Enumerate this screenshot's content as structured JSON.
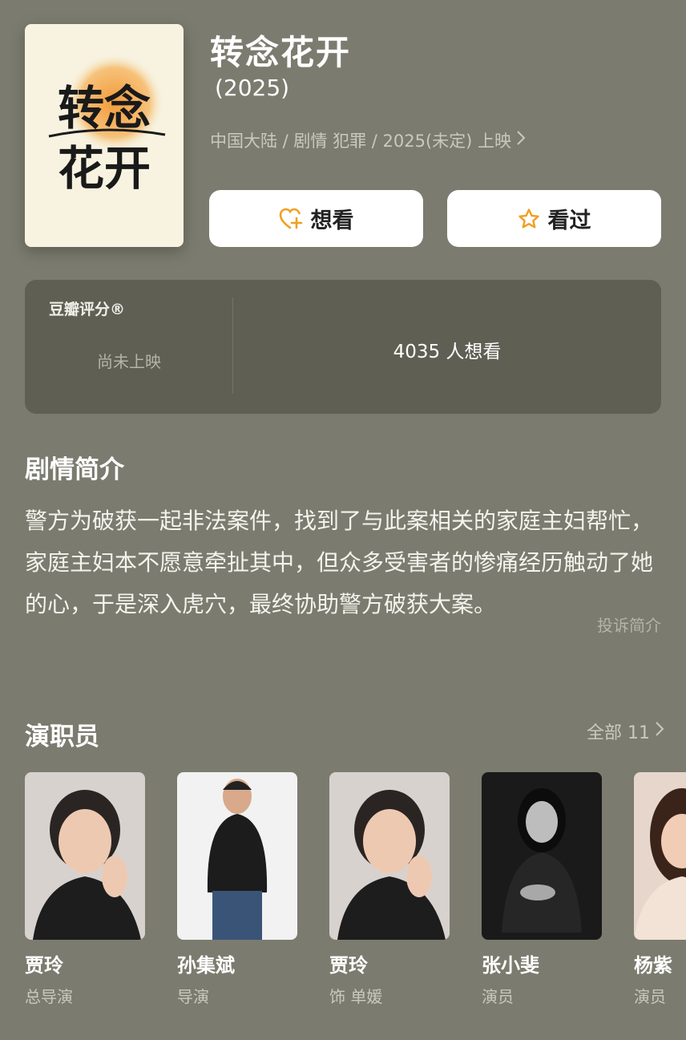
{
  "movie": {
    "poster_text": "转念花开",
    "title": "转念花开",
    "year": "(2025)",
    "meta": "中国大陆 / 剧情 犯罪 / 2025(未定) 上映"
  },
  "actions": {
    "want_label": "想看",
    "seen_label": "看过"
  },
  "rating": {
    "label": "豆瓣评分®",
    "status": "尚未上映",
    "want_count": "4035 人想看"
  },
  "synopsis": {
    "heading": "剧情简介",
    "body": "警方为破获一起非法案件，找到了与此案相关的家庭主妇帮忙，家庭主妇本不愿意牵扯其中，但众多受害者的惨痛经历触动了她的心，于是深入虎穴，最终协助警方破获大案。",
    "report": "投诉简介"
  },
  "cast": {
    "heading": "演职员",
    "all_label": "全部 11",
    "members": [
      {
        "name": "贾玲",
        "role": "总导演"
      },
      {
        "name": "孙集斌",
        "role": "导演"
      },
      {
        "name": "贾玲",
        "role": "饰 单媛"
      },
      {
        "name": "张小斐",
        "role": "演员"
      },
      {
        "name": "杨紫",
        "role": "演员"
      }
    ]
  },
  "colors": {
    "background": "#7b7b6f",
    "card": "#5f5f54",
    "accent_icon": "#f0a020"
  },
  "icons": [
    "heart-plus-icon",
    "star-icon",
    "chevron-right-icon"
  ]
}
